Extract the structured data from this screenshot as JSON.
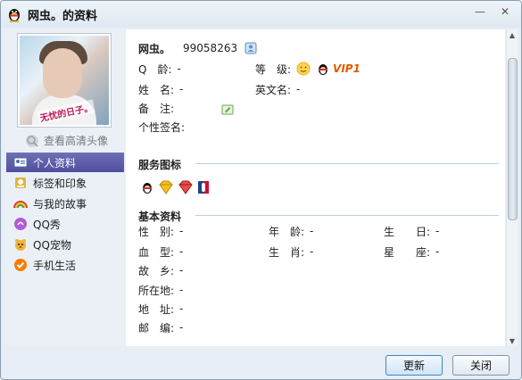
{
  "window": {
    "title": "网虫。的资料",
    "minimize_glyph": "—",
    "close_glyph": "✕"
  },
  "sidebar": {
    "avatar_caption": "无忧的日子。",
    "hd_link": "查看高清头像",
    "items": [
      {
        "label": "个人资料",
        "icon": "profile-card-icon"
      },
      {
        "label": "标签和印象",
        "icon": "tag-icon"
      },
      {
        "label": "与我的故事",
        "icon": "rainbow-icon"
      },
      {
        "label": "QQ秀",
        "icon": "qq-show-icon"
      },
      {
        "label": "QQ宠物",
        "icon": "pet-icon"
      },
      {
        "label": "手机生活",
        "icon": "mobile-check-icon"
      }
    ]
  },
  "profile": {
    "nickname": "网虫。",
    "qq_number": "99058263",
    "age_label": "Q　龄:",
    "age_value": "-",
    "level_label": "等　级:",
    "vip_text": "VIP1",
    "name_label": "姓　名:",
    "name_value": "-",
    "english_name_label": "英文名:",
    "english_name_value": "-",
    "remark_label": "备　注:",
    "signature_label": "个性签名:"
  },
  "services": {
    "title": "服务图标"
  },
  "basic": {
    "title": "基本资料",
    "gender_label": "性　别:",
    "gender_value": "-",
    "age_label": "年　龄:",
    "age_value": "-",
    "birthday_label": "生　　日:",
    "birthday_value": "-",
    "blood_label": "血　型:",
    "blood_value": "-",
    "zodiac_label": "生　肖:",
    "zodiac_value": "-",
    "constellation_label": "星　　座:",
    "constellation_value": "-",
    "hometown_label": "故　乡:",
    "hometown_value": "-",
    "location_label": "所在地:",
    "location_value": "-",
    "address_label": "地　址:",
    "address_value": "-",
    "zipcode_label": "邮　编:",
    "zipcode_value": "-"
  },
  "buttons": {
    "refresh": "更新",
    "close": "关闭"
  },
  "colors": {
    "accent_nav": "#5656a6",
    "vip": "#e05a00",
    "section_line": "#bcd0e0"
  }
}
